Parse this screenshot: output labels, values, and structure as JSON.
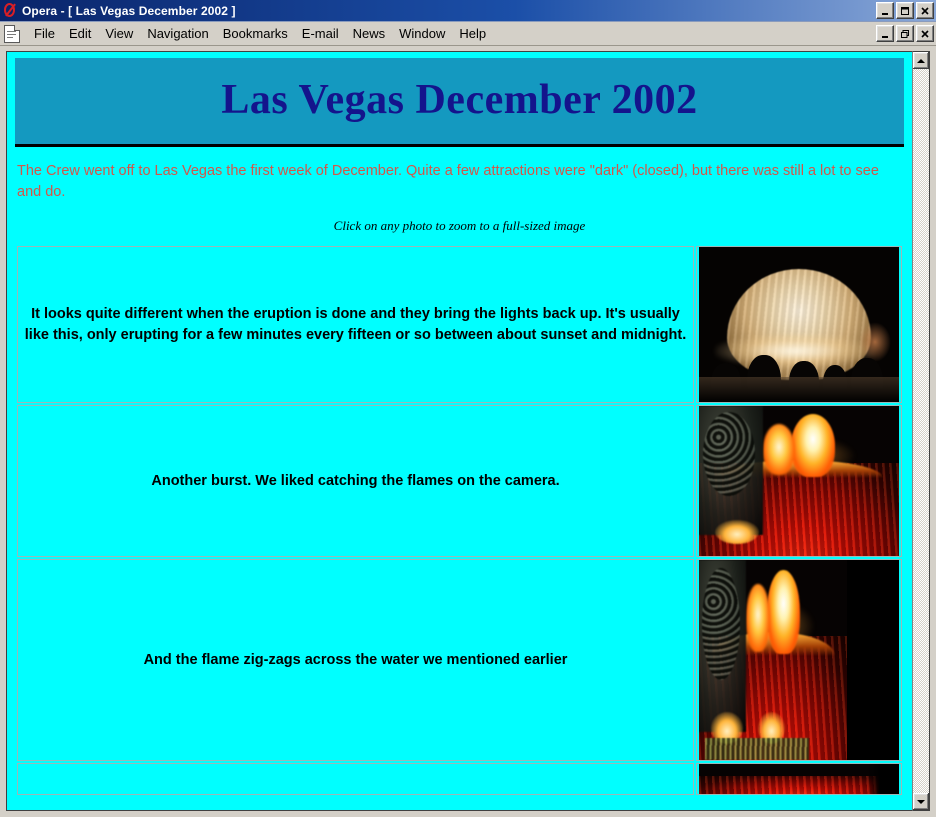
{
  "window": {
    "app_name": "Opera",
    "title": "Opera - [ Las Vegas December 2002 ]",
    "buttons": {
      "minimize": "minimize-button",
      "maximize": "maximize-button",
      "close": "close-button"
    }
  },
  "menubar": {
    "document_icon": "document-icon",
    "items": [
      {
        "label": "File"
      },
      {
        "label": "Edit"
      },
      {
        "label": "View"
      },
      {
        "label": "Navigation"
      },
      {
        "label": "Bookmarks"
      },
      {
        "label": "E-mail"
      },
      {
        "label": "News"
      },
      {
        "label": "Window"
      },
      {
        "label": "Help"
      }
    ],
    "mdi_buttons": {
      "minimize": "mdi-minimize-button",
      "restore": "mdi-restore-button",
      "close": "mdi-close-button"
    }
  },
  "page": {
    "heading": "Las Vegas December 2002",
    "intro": "The Crew went off to Las Vegas the first week of December. Quite a few attractions were \"dark\" (closed), but there was still a lot to see and do.",
    "click_note": "Click on any photo to zoom to a full-sized image",
    "rows": [
      {
        "caption": "It looks quite different when the eruption is done and they bring the lights back up. It's usually like this, only erupting for a few minutes every fifteen or so between about sunset and midnight.",
        "photo_name": "photo-volcano-lights-up"
      },
      {
        "caption": "Another burst. We liked catching the flames on the camera.",
        "photo_name": "photo-volcano-burst"
      },
      {
        "caption": "And the flame zig-zags across the water we mentioned earlier",
        "photo_name": "photo-volcano-zigzag"
      },
      {
        "caption": "",
        "photo_name": "photo-volcano-next"
      }
    ]
  },
  "scrollbar": {
    "up_icon": "scroll-up-arrow-icon",
    "down_icon": "scroll-down-arrow-icon"
  },
  "colors": {
    "page_background": "#00ffff",
    "banner": "#1499c0",
    "heading_text": "#14148c",
    "intro_text": "#d2574a",
    "caption_text": "#000000",
    "titlebar": "#0a246a",
    "chrome": "#d4d0c8"
  }
}
